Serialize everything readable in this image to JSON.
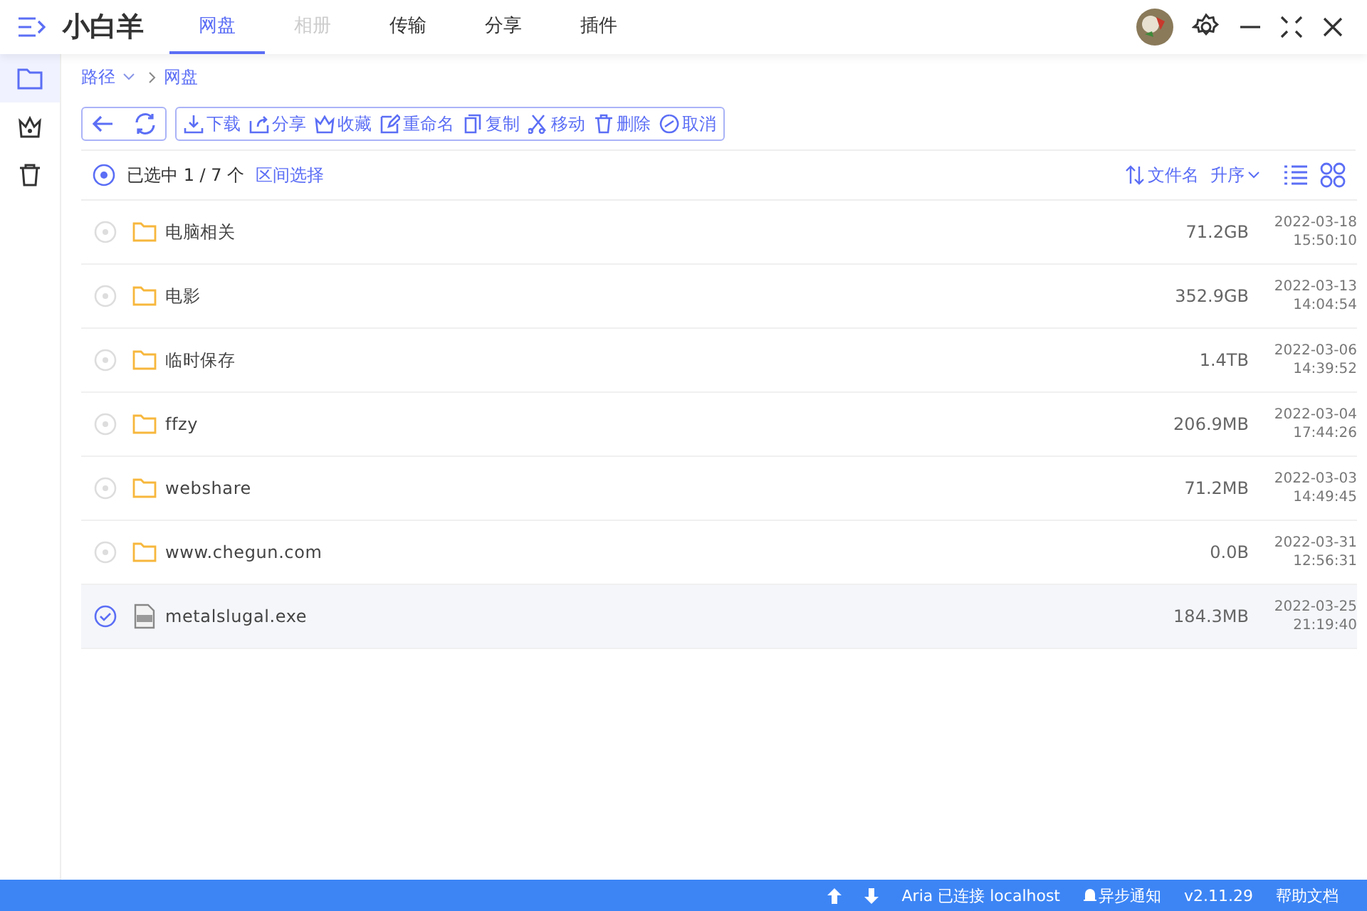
{
  "app": {
    "title": "小白羊"
  },
  "tabs": [
    {
      "label": "网盘",
      "selected": true,
      "disabled": false
    },
    {
      "label": "相册",
      "selected": false,
      "disabled": true
    },
    {
      "label": "传输",
      "selected": false,
      "disabled": false
    },
    {
      "label": "分享",
      "selected": false,
      "disabled": false
    },
    {
      "label": "插件",
      "selected": false,
      "disabled": false
    }
  ],
  "sidebar": {
    "items": [
      {
        "kind": "folder",
        "selected": true
      },
      {
        "kind": "crown",
        "selected": false
      },
      {
        "kind": "trash",
        "selected": false
      }
    ]
  },
  "breadcrumb": {
    "root": "路径",
    "path": "网盘"
  },
  "toolbar": {
    "actions": [
      {
        "kind": "download",
        "label": "下载"
      },
      {
        "kind": "share",
        "label": "分享"
      },
      {
        "kind": "favorite",
        "label": "收藏"
      },
      {
        "kind": "rename",
        "label": "重命名"
      },
      {
        "kind": "copy",
        "label": "复制"
      },
      {
        "kind": "move",
        "label": "移动"
      },
      {
        "kind": "delete",
        "label": "删除"
      },
      {
        "kind": "cancel",
        "label": "取消"
      }
    ]
  },
  "selection": {
    "partial": true,
    "summary": "已选中 1 / 7 个",
    "range_link": "区间选择",
    "sort_field": "文件名",
    "sort_order": "升序"
  },
  "files": [
    {
      "kind": "folder",
      "name": "电脑相关",
      "size": "71.2GB",
      "date": "2022-03-18",
      "time": "15:50:10",
      "selected": false
    },
    {
      "kind": "folder",
      "name": "电影",
      "size": "352.9GB",
      "date": "2022-03-13",
      "time": "14:04:54",
      "selected": false
    },
    {
      "kind": "folder",
      "name": "临时保存",
      "size": "1.4TB",
      "date": "2022-03-06",
      "time": "14:39:52",
      "selected": false
    },
    {
      "kind": "folder",
      "name": "ffzy",
      "size": "206.9MB",
      "date": "2022-03-04",
      "time": "17:44:26",
      "selected": false
    },
    {
      "kind": "folder",
      "name": "webshare",
      "size": "71.2MB",
      "date": "2022-03-03",
      "time": "14:49:45",
      "selected": false
    },
    {
      "kind": "folder",
      "name": "www.chegun.com",
      "size": "0.0B",
      "date": "2022-03-31",
      "time": "12:56:31",
      "selected": false
    },
    {
      "kind": "file",
      "name": "metalslugal.exe",
      "size": "184.3MB",
      "date": "2022-03-25",
      "time": "21:19:40",
      "selected": true
    }
  ],
  "status_bar": {
    "aria": "Aria 已连接 localhost",
    "notify": "异步通知",
    "version": "v2.11.29",
    "help": "帮助文档"
  }
}
